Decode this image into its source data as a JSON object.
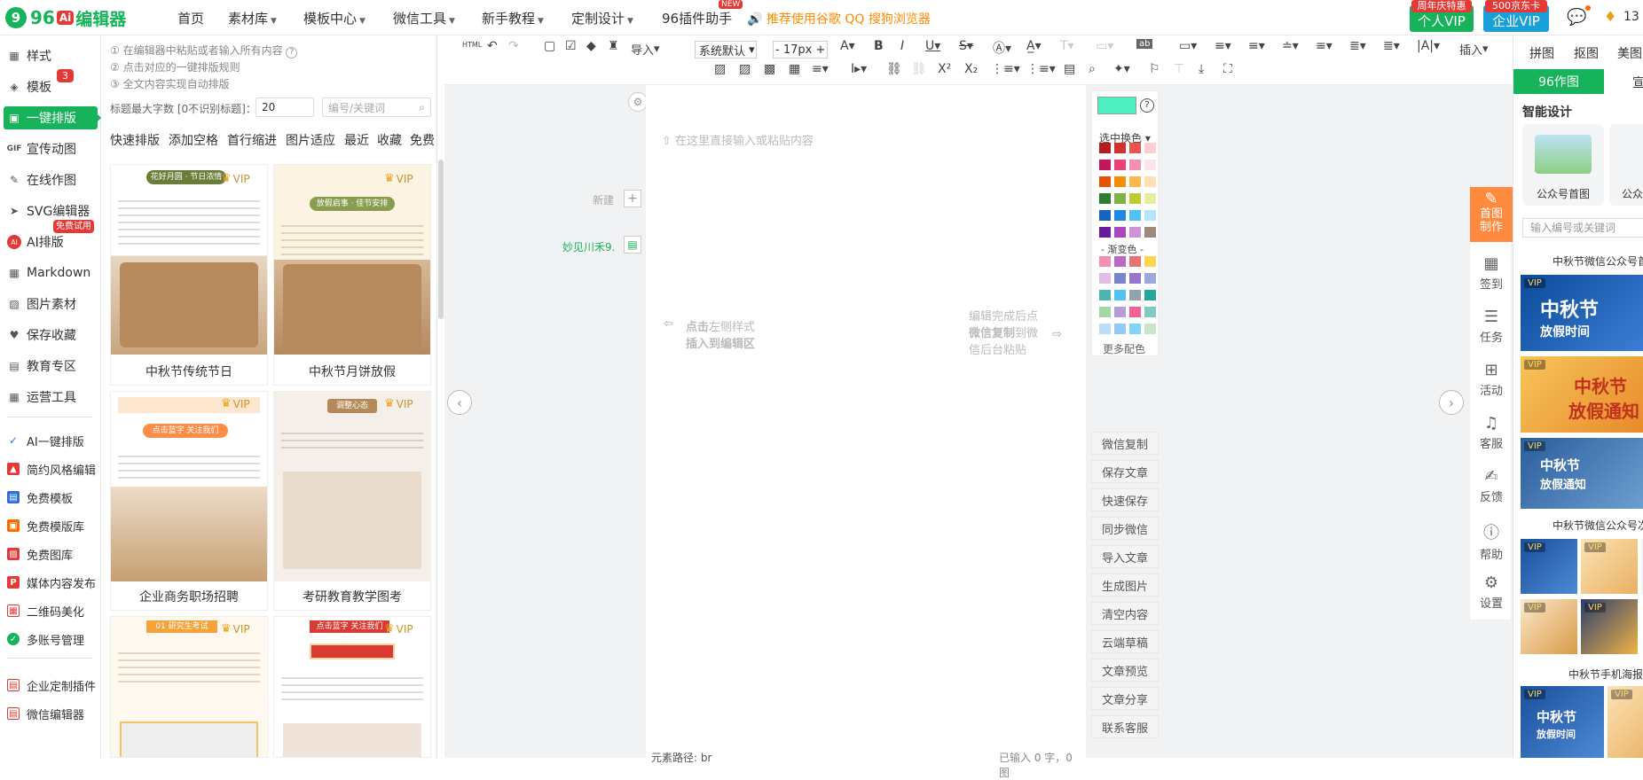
{
  "nav": {
    "logo_num": "96",
    "logo_ai": "Ai",
    "logo_text": "编辑器",
    "items": [
      {
        "label": "首页",
        "dd": false
      },
      {
        "label": "素材库",
        "dd": true
      },
      {
        "label": "模板中心",
        "dd": true
      },
      {
        "label": "微信工具",
        "dd": true
      },
      {
        "label": "新手教程",
        "dd": true
      },
      {
        "label": "定制设计",
        "dd": true
      },
      {
        "label": "96插件助手",
        "dd": false
      }
    ],
    "new_badge": "NEW",
    "recommend": "推荐使用谷歌 QQ 搜狗浏览器",
    "personal_vip": "个人VIP",
    "personal_tag": "周年庆特惠",
    "enterprise_vip": "企业VIP",
    "enterprise_tag": "500京东卡",
    "user_num": "13"
  },
  "sidebar": {
    "items": [
      {
        "label": "样式",
        "icon": "grid-icon"
      },
      {
        "label": "模板",
        "icon": "layers-icon"
      },
      {
        "label": "一键排版",
        "icon": "doc-icon"
      },
      {
        "label": "宣传动图",
        "icon": "gif-icon"
      },
      {
        "label": "在线作图",
        "icon": "edit-icon"
      },
      {
        "label": "SVG编辑器",
        "icon": "cursor-icon"
      },
      {
        "label": "AI排版",
        "icon": "ai-icon"
      },
      {
        "label": "Markdown",
        "icon": "grid-icon"
      },
      {
        "label": "图片素材",
        "icon": "image-icon"
      },
      {
        "label": "保存收藏",
        "icon": "heart-icon"
      },
      {
        "label": "教育专区",
        "icon": "book-icon"
      },
      {
        "label": "运营工具",
        "icon": "grid-icon"
      }
    ],
    "template_badge": "3",
    "ai_badge": "免费试用",
    "sub_items": [
      {
        "label": "AI一键排版",
        "color": "#2f6ee0"
      },
      {
        "label": "简约风格编辑",
        "color": "#e53935"
      },
      {
        "label": "免费模板",
        "color": "#2f6ee0"
      },
      {
        "label": "免费模版库",
        "color": "#ff6a00"
      },
      {
        "label": "免费图库",
        "color": "#e53935"
      },
      {
        "label": "媒体内容发布",
        "color": "#e53935"
      },
      {
        "label": "二维码美化",
        "color": "#e53935"
      },
      {
        "label": "多账号管理",
        "color": "#16b35a"
      },
      {
        "label": "企业定制插件",
        "color": "#e53935"
      },
      {
        "label": "微信编辑器",
        "color": "#e53935"
      }
    ]
  },
  "panel": {
    "tips": [
      "① 在编辑器中粘贴或者输入所有内容",
      "② 点击对应的一键排版规则",
      "③ 全文内容实现自动排版"
    ],
    "title_label": "标题最大字数 [0不识别标题]：",
    "title_value": "20",
    "search_placeholder": "编号/关键词",
    "categories": [
      "快速排版",
      "添加空格",
      "首行缩进",
      "图片适应",
      "最近",
      "收藏",
      "免费"
    ],
    "vip": "VIP",
    "cards": [
      {
        "caption": "中秋节传统节日",
        "banner": "花好月圆 · 节日浓情"
      },
      {
        "caption": "中秋节月饼放假",
        "banner": "放假启事 · 佳节安排"
      },
      {
        "caption": "企业商务职场招聘",
        "banner": "点击蓝字 关注我们"
      },
      {
        "caption": "考研教育教学图考",
        "banner": "调整心态"
      },
      {
        "caption": "",
        "banner": "01 研究生考试"
      },
      {
        "caption": "",
        "banner": "点击蓝字 关注我们"
      }
    ]
  },
  "toolbar": {
    "import": "导入",
    "font": "系统默认",
    "size": "17px",
    "insert": "插入"
  },
  "editor": {
    "placeholder": "在这里直接输入或粘贴内容",
    "new_label": "新建",
    "user_label": "妙见川禾9.",
    "hint_left_1": "点击",
    "hint_left_2": "左侧样式",
    "hint_left_3": "插入到编辑区",
    "hint_right_1": "编辑完成后点",
    "hint_right_2": "微信复制",
    "hint_right_3": "到微",
    "hint_right_4": "信后台粘贴",
    "footer_path": "元素路径: br",
    "footer_count": "已输入 0 字，0 图"
  },
  "colors": {
    "current": "#4eefc0",
    "select_label": "选中换色",
    "gradient_label": "- 渐变色 -",
    "more_label": "更多配色"
  },
  "actions": [
    "微信复制",
    "保存文章",
    "快速保存",
    "同步微信",
    "导入文章",
    "生成图片",
    "清空内容",
    "云端草稿",
    "文章预览",
    "文章分享",
    "联系客服"
  ],
  "righttools": [
    {
      "label": "首图制作",
      "icon": "paint-icon"
    },
    {
      "label": "签到",
      "icon": "calendar-icon"
    },
    {
      "label": "任务",
      "icon": "task-icon"
    },
    {
      "label": "活动",
      "icon": "gift-icon"
    },
    {
      "label": "客服",
      "icon": "headset-icon"
    },
    {
      "label": "反馈",
      "icon": "feedback-icon"
    },
    {
      "label": "帮助",
      "icon": "help-icon"
    },
    {
      "label": "设置",
      "icon": "gear-icon"
    }
  ],
  "rightpanel": {
    "tabs": [
      "拼图",
      "抠图",
      "美图"
    ],
    "subtabs": [
      "96作图",
      "宣"
    ],
    "smart_label": "智能设计",
    "thumb_label": "公众号首图",
    "thumb_label2": "公众",
    "search_placeholder": "输入编号或关键词",
    "section1": "中秋节微信公众号首",
    "section2": "中秋节微信公众号次",
    "section3": "中秋节手机海报",
    "t1": "中秋节",
    "t1b": "放假时间",
    "t2": "中秋节",
    "t2b": "放假通知",
    "t3": "中秋节",
    "t3b": "放假通知",
    "vip": "VIP"
  }
}
